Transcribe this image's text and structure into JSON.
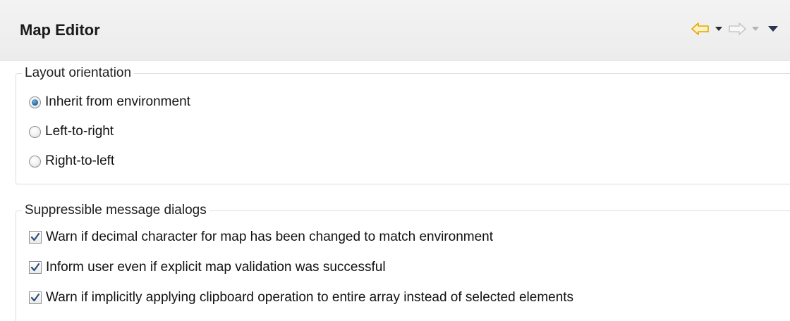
{
  "header": {
    "title": "Map Editor",
    "nav": {
      "back_icon": "back-arrow-icon",
      "back_dropdown_icon": "dropdown-triangle-icon",
      "forward_icon": "forward-arrow-icon",
      "forward_dropdown_icon": "dropdown-triangle-icon",
      "view_menu_icon": "view-menu-triangle-icon",
      "back_color": "#e8a400",
      "forward_color": "#c8c8c8"
    }
  },
  "layout_orientation": {
    "legend": "Layout orientation",
    "options": [
      {
        "label": "Inherit from environment",
        "selected": true
      },
      {
        "label": "Left-to-right",
        "selected": false
      },
      {
        "label": "Right-to-left",
        "selected": false
      }
    ]
  },
  "suppressible_dialogs": {
    "legend": "Suppressible message dialogs",
    "items": [
      {
        "label": "Warn if decimal character for map has been changed to match environment",
        "checked": true
      },
      {
        "label": "Inform user even if explicit map validation was successful",
        "checked": true
      },
      {
        "label": "Warn if implicitly applying clipboard operation to entire array instead of selected elements",
        "checked": true
      }
    ]
  },
  "colors": {
    "group_border": "#d5dfe5",
    "check_mark": "#2a4f7a",
    "radio_dot": "#1f5f9a"
  }
}
